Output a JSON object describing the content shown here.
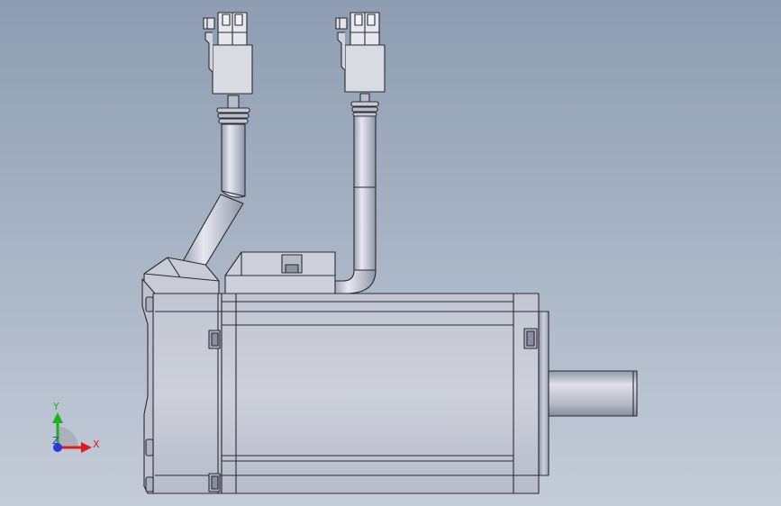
{
  "triad": {
    "y_label": "Y",
    "x_label": "X",
    "z_label": "Z",
    "colors": {
      "x": "#e01b1b",
      "y": "#1fb31f",
      "z": "#2a3ad8"
    }
  },
  "model": {
    "outline_color": "#2a2a33",
    "body_color": "#c9ccd6",
    "shade_color": "#a9adbb"
  }
}
